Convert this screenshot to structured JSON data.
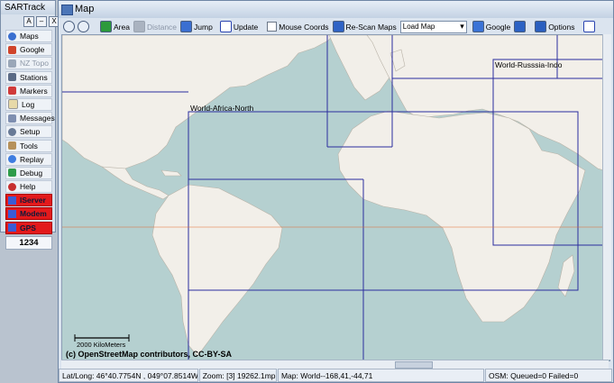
{
  "side_panel": {
    "title": "SARTrack",
    "controls": [
      "A",
      "–",
      "X"
    ],
    "items": [
      {
        "label": "Maps",
        "icon": "globe-icon",
        "color": "#3a6fd0"
      },
      {
        "label": "Google",
        "icon": "google-icon",
        "color": "#d0442b"
      },
      {
        "label": "NZ Topo",
        "icon": "topo-icon",
        "color": "#9aa7b8",
        "disabled": true
      },
      {
        "label": "Stations",
        "icon": "station-icon",
        "color": "#5b6b86"
      },
      {
        "label": "Markers",
        "icon": "marker-icon",
        "color": "#d03a3a"
      },
      {
        "label": "Log",
        "icon": "log-icon",
        "color": "#e7d9a8"
      },
      {
        "label": "Messages",
        "icon": "messages-icon",
        "color": "#7f8fb0"
      },
      {
        "label": "Setup",
        "icon": "gear-icon",
        "color": "#687a96"
      },
      {
        "label": "Tools",
        "icon": "tools-icon",
        "color": "#b6915a"
      },
      {
        "label": "Replay",
        "icon": "replay-icon",
        "color": "#3e7de0"
      },
      {
        "label": "Debug",
        "icon": "debug-icon",
        "color": "#2f9c4a"
      },
      {
        "label": "Help",
        "icon": "help-icon",
        "color": "#c72f2f"
      }
    ],
    "status_items": [
      {
        "label": "IServer"
      },
      {
        "label": "Modem"
      },
      {
        "label": "GPS"
      }
    ],
    "counter": "1234"
  },
  "window": {
    "title": "Map",
    "toolbar": {
      "zoom_in_icon": "zoom-in-icon",
      "zoom_out_icon": "zoom-out-icon",
      "area": "Area",
      "distance": "Distance",
      "jump": "Jump",
      "update": "Update",
      "mouse_coords": "Mouse Coords",
      "rescan": "Re-Scan Maps",
      "load_map": "Load Map",
      "google": "Google",
      "options": "Options",
      "help_icon": "help-icon"
    },
    "map": {
      "region_labels": [
        "World-Africa-North",
        "World-Russsia-Indo"
      ],
      "scale": "2000 KiloMeters",
      "attribution": "(c) OpenStreetMap contributors, CC-BY-SA",
      "colors": {
        "water": "#b5d0d0",
        "land": "#f2efe9",
        "boundary": "#2b2e9e"
      }
    },
    "status": {
      "latlong": "Lat/Long: 46°40.7754N , 049°07.8514W",
      "zoom": "Zoom: [3] 19262.1mpp",
      "map": "Map: World--168,41,-44,71",
      "osm": "OSM: Queued=0 Failed=0"
    }
  }
}
